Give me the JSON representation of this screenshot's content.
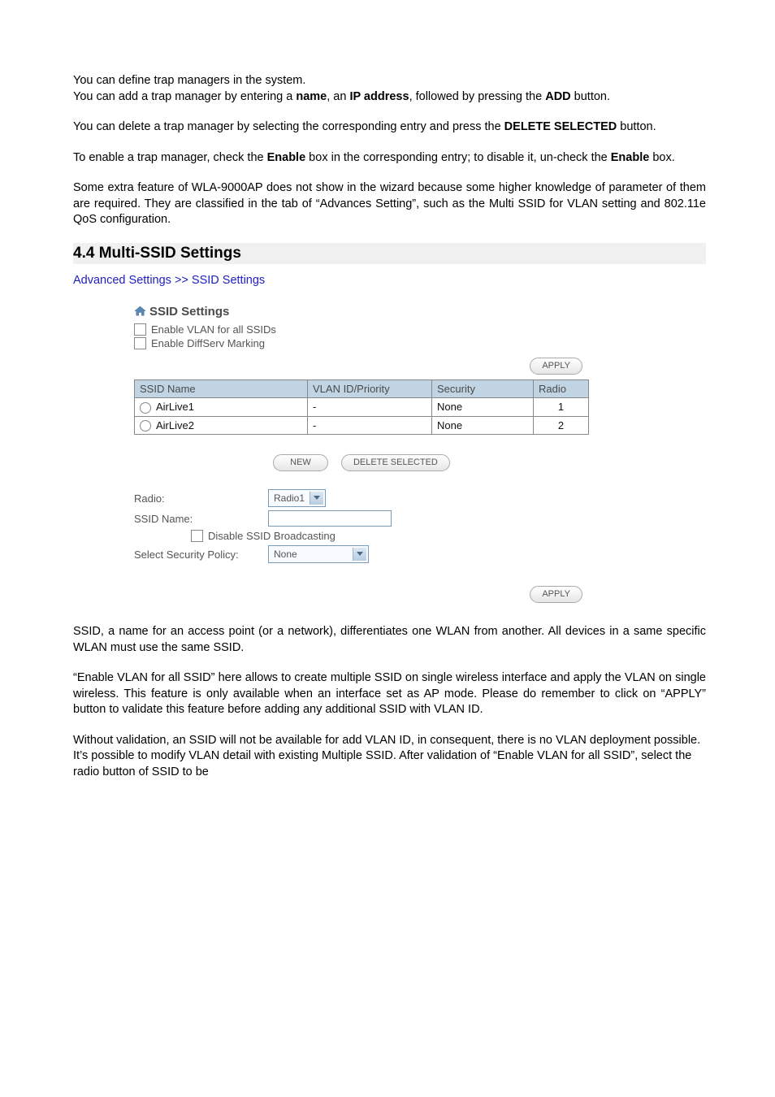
{
  "para": {
    "p1a": "You can define trap managers in the system.",
    "p1b_pre": "You can add a trap manager by entering a ",
    "p1b_name": "name",
    "p1b_mid1": ", an ",
    "p1b_ip": "IP address",
    "p1b_mid2": ", followed by pressing the ",
    "p1b_add": "ADD",
    "p1b_post": " button.",
    "p2_pre": "You can delete a trap manager by selecting the corresponding entry and press the ",
    "p2_del": "DELETE SELECTED",
    "p2_post": " button.",
    "p3_pre": "To enable a trap manager, check the ",
    "p3_en": "Enable",
    "p3_mid": " box in the corresponding entry; to disable it, un-check the ",
    "p3_en2": "Enable",
    "p3_post": " box.",
    "p4": "Some extra feature of WLA-9000AP does not show in the wizard because some higher knowledge of parameter of them are required. They are classified in the tab of “Advances Setting”, such as the Multi SSID for VLAN setting and 802.11e QoS configuration.",
    "p5": "SSID, a name for an access point (or a network), differentiates one WLAN from another. All devices in a same specific WLAN must use the same SSID.",
    "p6": "“Enable VLAN for all SSID” here allows to create multiple SSID on single wireless interface and apply the VLAN on single wireless. This feature is only available when an interface set as AP mode. Please do remember to click on “APPLY” button to validate this feature before adding any additional SSID with VLAN ID.",
    "p7": "Without validation, an SSID will not be available for add VLAN ID, in consequent, there is no VLAN deployment possible. It’s possible to modify VLAN detail with existing Multiple SSID. After validation of “Enable VLAN for all SSID”, select the radio button of SSID to be"
  },
  "heading": "4.4 Multi-SSID Settings",
  "breadcrumb": "Advanced Settings >> SSID Settings",
  "panel": {
    "title": "SSID Settings",
    "opt1": "Enable VLAN for all SSIDs",
    "opt2": "Enable DiffServ Marking",
    "apply": "APPLY",
    "headers": {
      "c1": "SSID Name",
      "c2": "VLAN ID/Priority",
      "c3": "Security",
      "c4": "Radio"
    },
    "rows": [
      {
        "name": "AirLive1",
        "vlan": "-",
        "sec": "None",
        "radio": "1"
      },
      {
        "name": "AirLive2",
        "vlan": "-",
        "sec": "None",
        "radio": "2"
      }
    ],
    "new_btn": "NEW",
    "delsel_btn": "DELETE SELECTED",
    "form": {
      "radio_label": "Radio:",
      "radio_value": "Radio1",
      "ssid_label": "SSID Name:",
      "disable_bcast": "Disable SSID Broadcasting",
      "sec_label": "Select Security Policy:",
      "sec_value": "None"
    }
  }
}
